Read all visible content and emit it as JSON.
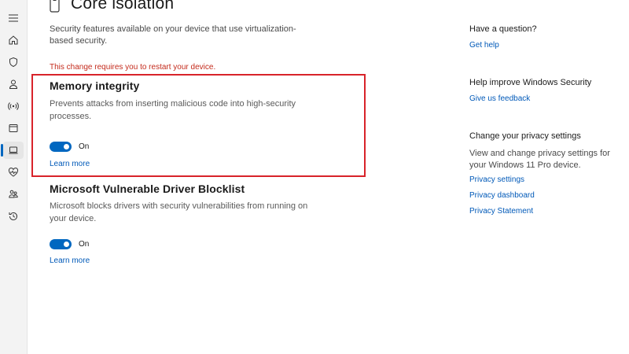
{
  "colors": {
    "accent": "#0067c0",
    "link": "#0059b8",
    "warning": "#c42b1c",
    "highlight_border": "#d8232a"
  },
  "nav": {
    "icons": [
      "menu-icon",
      "home-icon",
      "shield-icon",
      "person-icon",
      "network-icon",
      "app-browser-icon",
      "device-security-icon",
      "health-icon",
      "family-icon",
      "history-icon"
    ],
    "active": "device-security-icon"
  },
  "page": {
    "title": "Core isolation",
    "description": "Security features available on your device that use virtualization-based security.",
    "restart_warning": "This change requires you to restart your device."
  },
  "sections": [
    {
      "title": "Memory integrity",
      "description": "Prevents attacks from inserting malicious code into high-security processes.",
      "toggle_state": "On",
      "toggle_on": true,
      "link": "Learn more"
    },
    {
      "title": "Microsoft Vulnerable Driver Blocklist",
      "description": "Microsoft blocks drivers with security vulnerabilities from running on your device.",
      "toggle_state": "On",
      "toggle_on": true,
      "link": "Learn more"
    }
  ],
  "sidebar": {
    "question": {
      "heading": "Have a question?",
      "link": "Get help"
    },
    "improve": {
      "heading": "Help improve Windows Security",
      "link": "Give us feedback"
    },
    "privacy": {
      "heading": "Change your privacy settings",
      "text": "View and change privacy settings for your Windows 11 Pro device.",
      "links": [
        "Privacy settings",
        "Privacy dashboard",
        "Privacy Statement"
      ]
    }
  }
}
